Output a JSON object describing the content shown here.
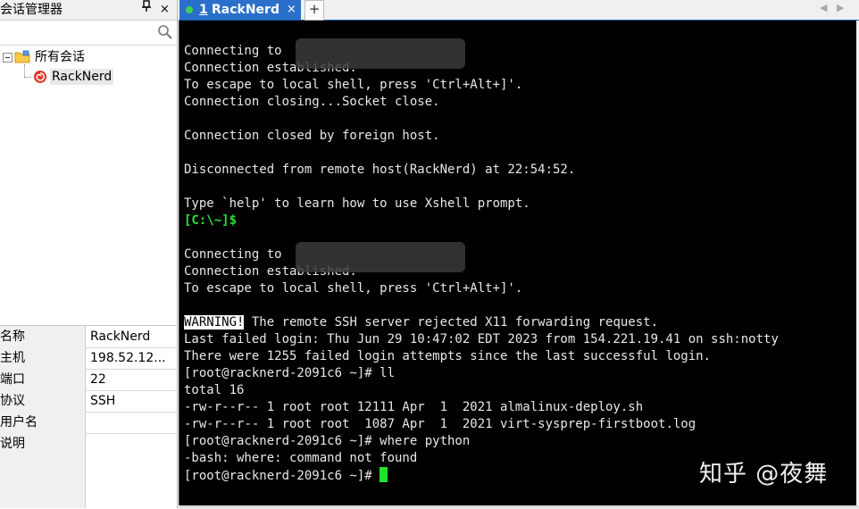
{
  "session_manager": {
    "title": "会话管理器",
    "pin_glyph": "ᵖ",
    "close_glyph": "×",
    "tree": {
      "root_label": "所有会话",
      "child_label": "RackNerd"
    },
    "properties": [
      {
        "key": "名称",
        "value": "RackNerd"
      },
      {
        "key": "主机",
        "value": "198.52.12..."
      },
      {
        "key": "端口",
        "value": "22"
      },
      {
        "key": "协议",
        "value": "SSH"
      },
      {
        "key": "用户名",
        "value": ""
      },
      {
        "key": "说明",
        "value": ""
      }
    ]
  },
  "tabs": {
    "active": {
      "number": "1",
      "label": "RackNerd",
      "close_glyph": "×"
    },
    "add_glyph": "+",
    "nav_prev": "◀",
    "nav_next": "▶"
  },
  "terminal": {
    "lines": [
      "Connecting to",
      "Connection established.",
      "To escape to local shell, press 'Ctrl+Alt+]'.",
      "Connection closing...Socket close.",
      "",
      "Connection closed by foreign host.",
      "",
      "Disconnected from remote host(RackNerd) at 22:54:52.",
      "",
      "Type `help' to learn how to use Xshell prompt.",
      "[C:\\~]$",
      "",
      "Connecting to",
      "Connection established.",
      "To escape to local shell, press 'Ctrl+Alt+]'.",
      "",
      " The remote SSH server rejected X11 forwarding request.",
      "Last failed login: Thu Jun 29 10:47:02 EDT 2023 from 154.221.19.41 on ssh:notty",
      "There were 1255 failed login attempts since the last successful login.",
      "[root@racknerd-2091c6 ~]# ll",
      "total 16",
      "-rw-r--r-- 1 root root 12111 Apr  1  2021 almalinux-deploy.sh",
      "-rw-r--r-- 1 root root  1087 Apr  1  2021 virt-sysprep-firstboot.log",
      "[root@racknerd-2091c6 ~]# where python",
      "-bash: where: command not found",
      "[root@racknerd-2091c6 ~]# "
    ],
    "warning_label": "WARNING!",
    "watermark": "知乎 @夜舞"
  },
  "colors": {
    "tab_active": "#2a6fc9",
    "terminal_bg": "#000000",
    "prompt_green": "#27e22a",
    "cursor": "#1ee32b"
  }
}
